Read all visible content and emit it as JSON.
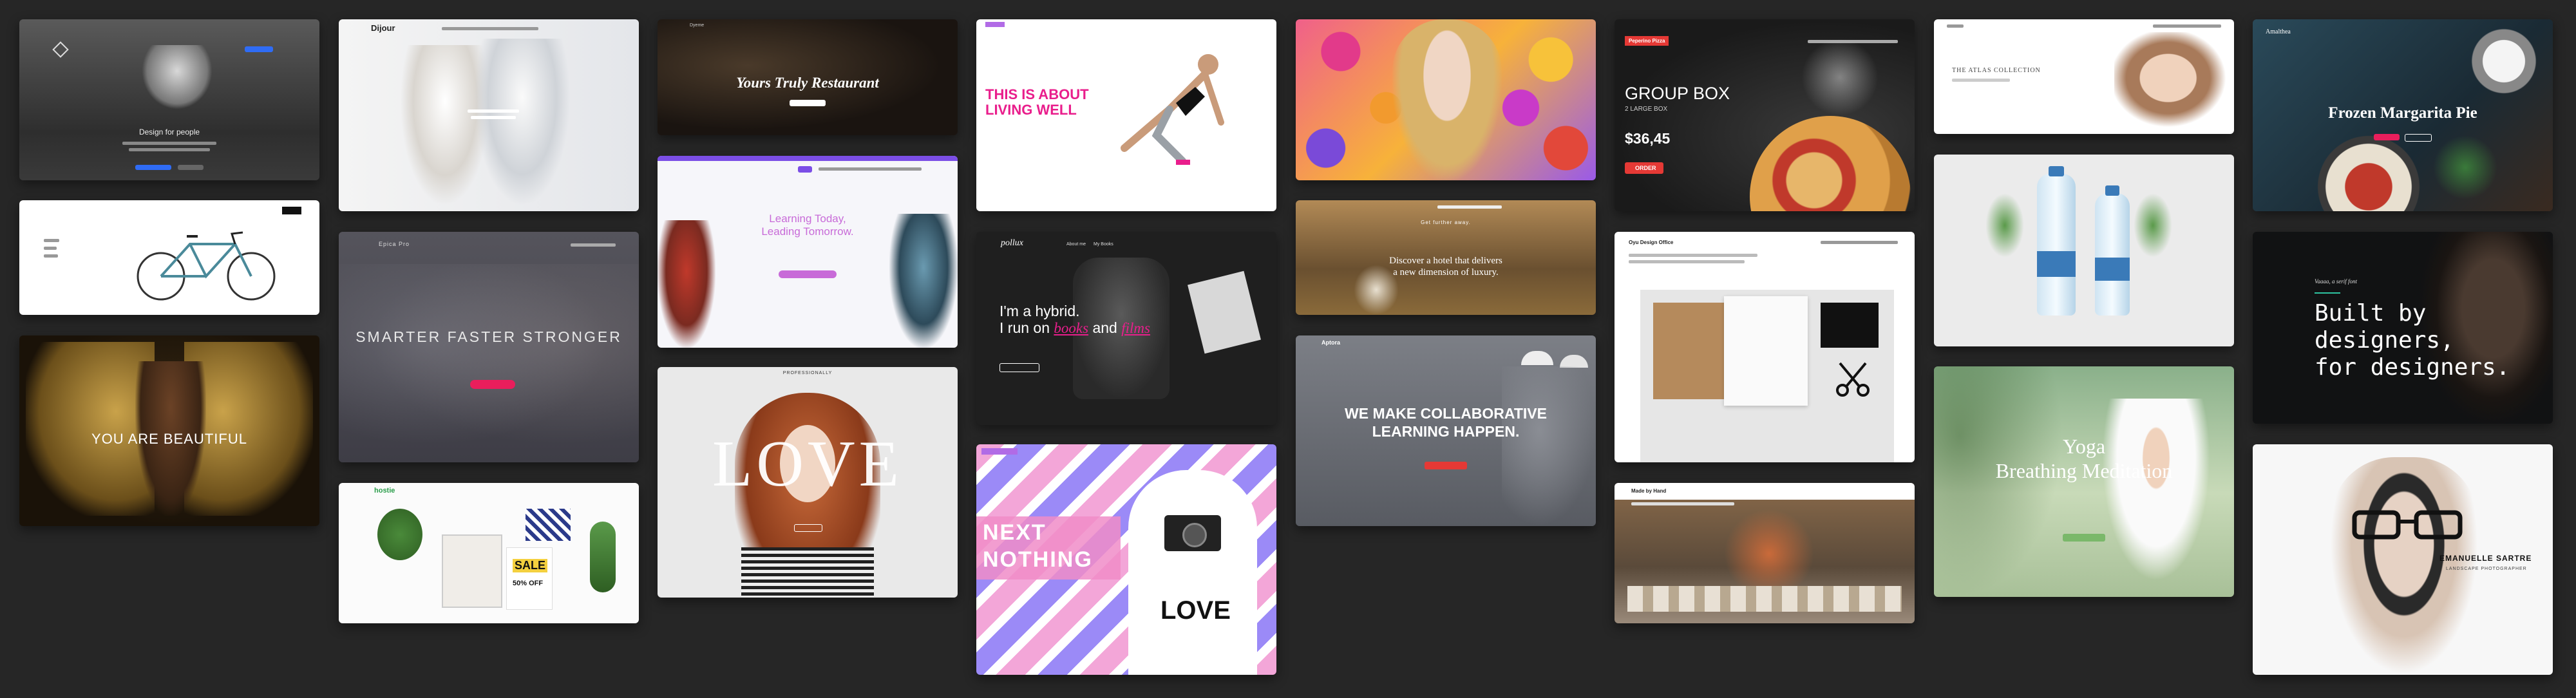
{
  "cards": {
    "design_for_people": {
      "heading": "Design for people"
    },
    "dijour": {
      "logo": "Dijour"
    },
    "restaurant": {
      "heading": "Yours Truly Restaurant",
      "logo": "Dyeme"
    },
    "living_well": {
      "heading_line1": "THIS IS ABOUT",
      "heading_line2": "LIVING WELL"
    },
    "group_box": {
      "logo": "Peperino Pizza",
      "heading": "GROUP BOX",
      "subheading": "2 LARGE BOX",
      "price": "$36,45",
      "button": "ORDER"
    },
    "atlas": {
      "heading": "THE ATLAS COLLECTION"
    },
    "margarita": {
      "heading": "Frozen Margarita Pie",
      "logo": "Amalthea"
    },
    "smarter": {
      "heading": "SMARTER FASTER STRONGER",
      "logo": "Epica Pro"
    },
    "learning": {
      "heading_line1": "Learning Today,",
      "heading_line2": "Leading Tomorrow."
    },
    "pollux": {
      "logo": "pollux",
      "heading_line1": "I'm a hybrid.",
      "heading_line2_a": "I run on ",
      "heading_line2_b": "books",
      "heading_line2_c": " and ",
      "heading_line2_d": "films",
      "nav1": "About me",
      "nav2": "My Books"
    },
    "hotel": {
      "pre": "Get further away.",
      "heading_line1": "Discover a hotel that delivers",
      "heading_line2": "a new dimension of luxury."
    },
    "design_office": {
      "logo": "Oyu Design Office"
    },
    "built": {
      "pre": "Vaaaa, a serif font",
      "heading_line1": "Built by",
      "heading_line2": "designers,",
      "heading_line3": "for designers."
    },
    "beautiful": {
      "heading": "YOU ARE BEAUTIFUL"
    },
    "collab": {
      "logo": "Aptora",
      "heading_line1": "WE MAKE COLLABORATIVE",
      "heading_line2": "LEARNING HAPPEN."
    },
    "yoga": {
      "heading_line1": "Yoga",
      "heading_line2": "Breathing Meditation"
    },
    "love": {
      "heading": "LOVE",
      "pre": "PROFESSIONALLY"
    },
    "next": {
      "heading_line1": "NEXT",
      "heading_line2": "NOTHING",
      "shirt": "LOVE"
    },
    "made_by_hand": {
      "logo": "Made by Hand"
    },
    "sartre": {
      "name": "EMANUELLE SARTRE",
      "pre": "LANDSCAPE PHOTOGRAPHER"
    },
    "hostie": {
      "logo": "hostie",
      "sale": "SALE",
      "discount": "50% OFF"
    }
  },
  "colors": {
    "background": "#262626",
    "pink": "#e91e8c",
    "red": "#e53935",
    "purple": "#7b4ee6"
  },
  "icons": [
    "camera-icon",
    "bicycle-icon",
    "backpack-icon",
    "pizza-icon",
    "scissors-icon",
    "glasses-icon",
    "bottle-icon",
    "plant-icon"
  ]
}
